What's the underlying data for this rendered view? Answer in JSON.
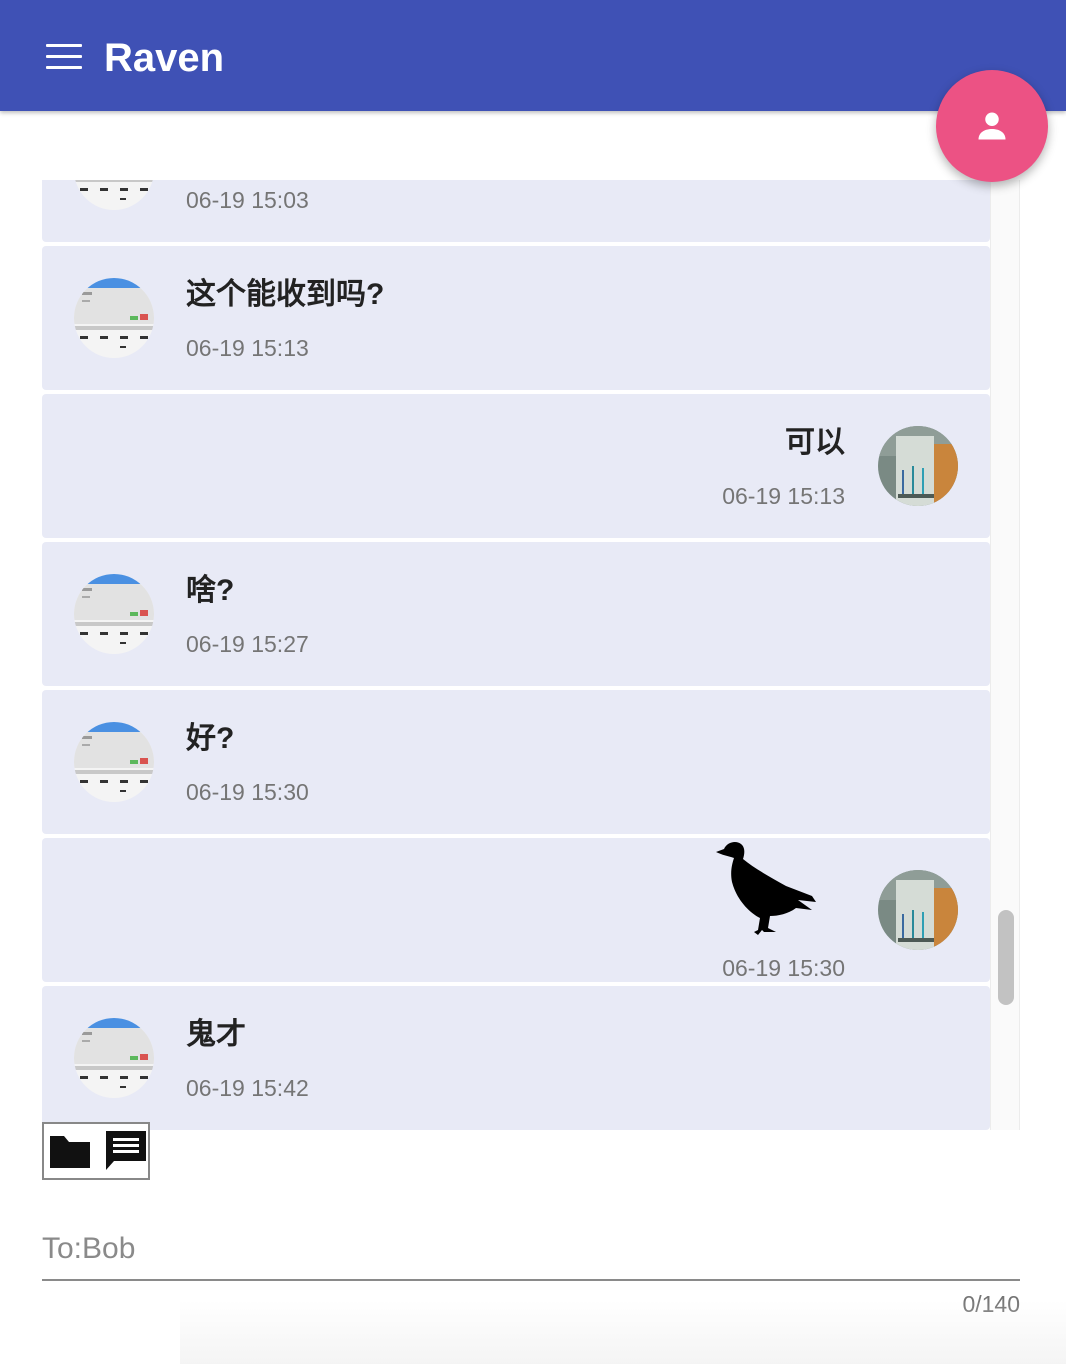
{
  "app": {
    "title": "Raven"
  },
  "header": {
    "menu_icon": "menu-icon",
    "fab_icon": "person-icon"
  },
  "messages": [
    {
      "side": "left",
      "kind": "text",
      "text": "",
      "time": "06-19 15:03",
      "avatar": "screenshot-avatar"
    },
    {
      "side": "left",
      "kind": "text",
      "text": "这个能收到吗?",
      "time": "06-19 15:13",
      "avatar": "screenshot-avatar"
    },
    {
      "side": "right",
      "kind": "text",
      "text": "可以",
      "time": "06-19 15:13",
      "avatar": "photo-avatar"
    },
    {
      "side": "left",
      "kind": "text",
      "text": "啥?",
      "time": "06-19 15:27",
      "avatar": "screenshot-avatar"
    },
    {
      "side": "left",
      "kind": "text",
      "text": "好?",
      "time": "06-19 15:30",
      "avatar": "screenshot-avatar"
    },
    {
      "side": "right",
      "kind": "image",
      "image": "raven-icon",
      "time": "06-19 15:30",
      "avatar": "photo-avatar"
    },
    {
      "side": "left",
      "kind": "text",
      "text": "鬼才",
      "time": "06-19 15:42",
      "avatar": "screenshot-avatar"
    },
    {
      "side": "left",
      "kind": "text",
      "text": "",
      "time": "",
      "avatar": "screenshot-avatar"
    }
  ],
  "composer": {
    "mode_buttons": [
      {
        "icon": "folder-icon"
      },
      {
        "icon": "message-icon"
      }
    ],
    "placeholder": "To:Bob",
    "value": "",
    "counter": "0/140"
  },
  "colors": {
    "appbar": "#3f51b5",
    "fab": "#ec5284",
    "message_bg": "#e8eaf6",
    "time_text": "#757575"
  }
}
